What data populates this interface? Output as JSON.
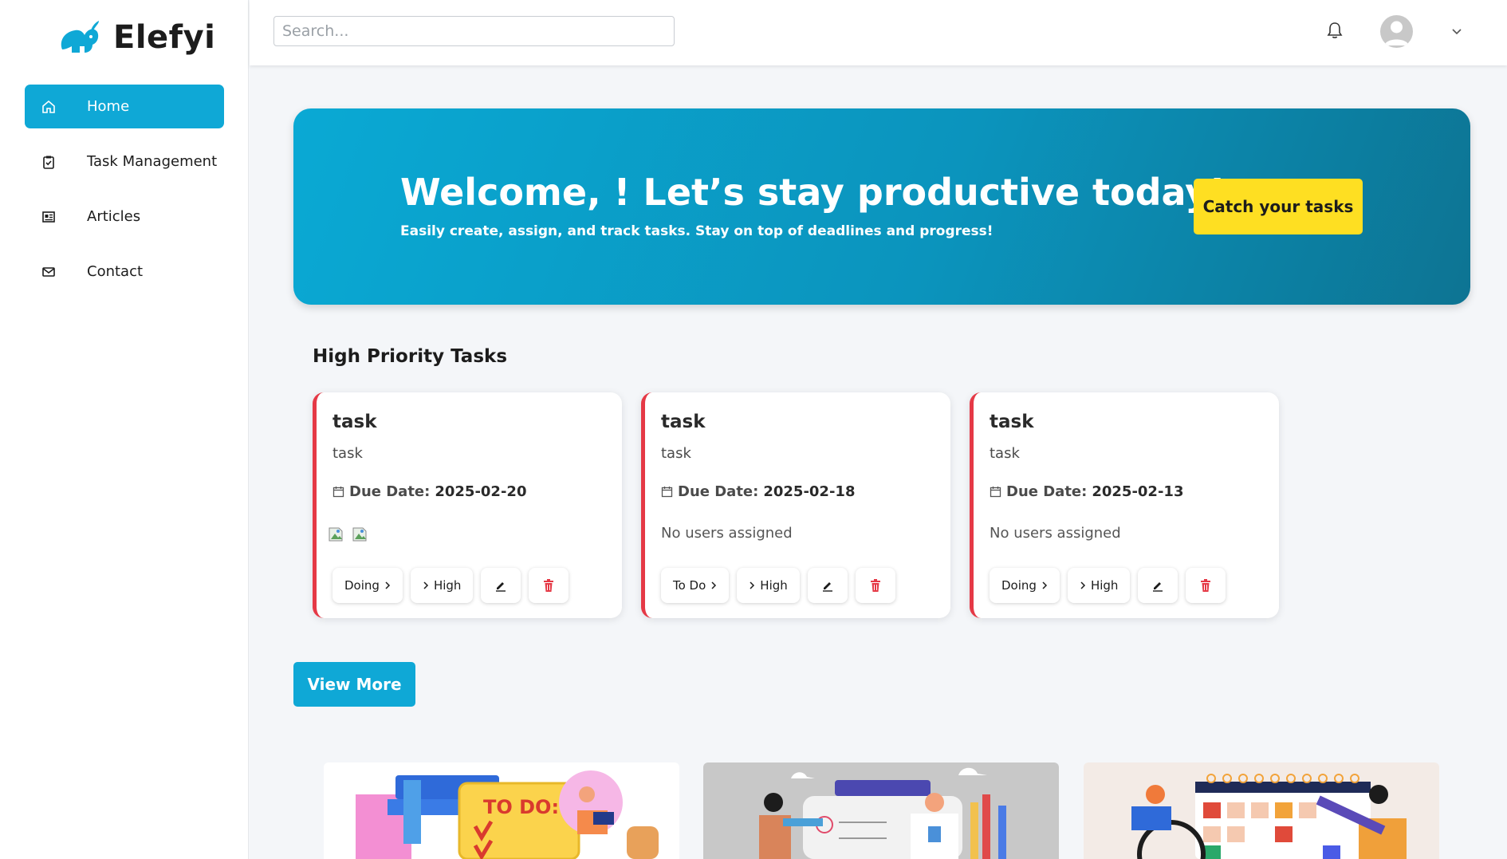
{
  "brand": {
    "name": "Elefyi",
    "accent": "#0fa8d6"
  },
  "sidebar": {
    "items": [
      {
        "label": "Home",
        "icon": "home-icon",
        "active": true
      },
      {
        "label": "Task Management",
        "icon": "clipboard-check-icon",
        "active": false
      },
      {
        "label": "Articles",
        "icon": "newspaper-icon",
        "active": false
      },
      {
        "label": "Contact",
        "icon": "mail-icon",
        "active": false
      }
    ]
  },
  "topbar": {
    "search_placeholder": "Search...",
    "icons": [
      "bell-icon",
      "user-avatar",
      "chevron-down-icon"
    ]
  },
  "hero": {
    "title": "Welcome, ! Let’s stay productive today!",
    "subtitle": "Easily create, assign, and track tasks. Stay on top of deadlines and progress!",
    "button_label": "Catch your tasks",
    "button_color": "#fedf22"
  },
  "high_priority": {
    "title": "High Priority Tasks",
    "due_label": "Due Date:",
    "tasks": [
      {
        "title": "task",
        "description": "task",
        "due_date": "2025-02-20",
        "users_text": "",
        "has_user_images": true,
        "status": "Doing",
        "priority": "High"
      },
      {
        "title": "task",
        "description": "task",
        "due_date": "2025-02-18",
        "users_text": "No users assigned",
        "has_user_images": false,
        "status": "To Do",
        "priority": "High"
      },
      {
        "title": "task",
        "description": "task",
        "due_date": "2025-02-13",
        "users_text": "No users assigned",
        "has_user_images": false,
        "status": "Doing",
        "priority": "High"
      }
    ],
    "priority_color": "#e53946"
  },
  "view_more_label": "View More",
  "illustrations": [
    {
      "name": "todo-illustration",
      "text": "TO DO:"
    },
    {
      "name": "team-planning-illustration"
    },
    {
      "name": "calendar-illustration"
    }
  ]
}
